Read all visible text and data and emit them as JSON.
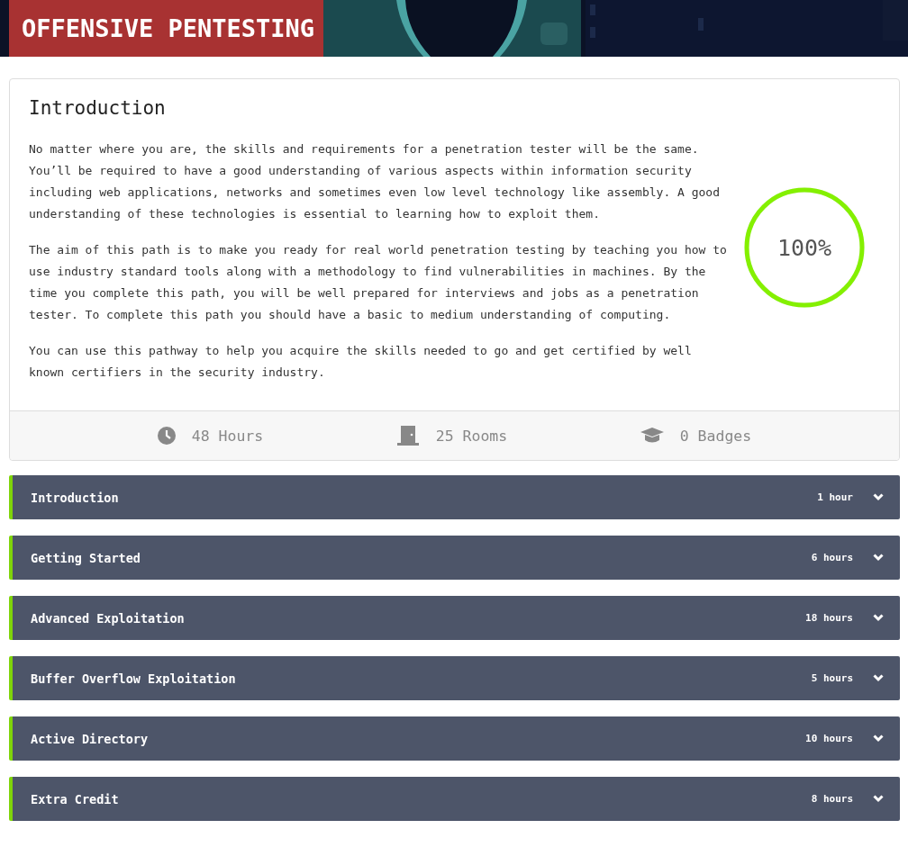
{
  "banner": {
    "title": "OFFENSIVE PENTESTING"
  },
  "intro": {
    "heading": "Introduction",
    "paragraphs": [
      "No matter where you are, the skills and requirements for a penetration tester will be the same. You’ll be required to have a good understanding of various aspects within information security including web applications, networks and sometimes even low level technology like assembly. A good understanding of these technologies is essential to learning how to exploit them.",
      "The aim of this path is to make you ready for real world penetration testing by teaching you how to use industry standard tools along with a methodology to find vulnerabilities in machines. By the time you complete this path, you will be well prepared for interviews and jobs as a penetration tester. To complete this path you should have a basic to medium understanding of computing.",
      "You can use this pathway to help you acquire the skills needed to go and get certified by well known certifiers in the security industry."
    ],
    "progress": {
      "level": 1,
      "reading": "100%"
    },
    "stats": [
      {
        "kind": "hours",
        "text": "48 Hours"
      },
      {
        "kind": "rooms",
        "text": "25 Rooms"
      },
      {
        "kind": "badges",
        "text": "0 Badges"
      }
    ]
  },
  "modules": [
    {
      "title": "Introduction",
      "duration": "1 hour"
    },
    {
      "title": "Getting Started",
      "duration": "6 hours"
    },
    {
      "title": "Advanced Exploitation",
      "duration": "18 hours"
    },
    {
      "title": "Buffer Overflow Exploitation",
      "duration": "5 hours"
    },
    {
      "title": "Active Directory",
      "duration": "10 hours"
    },
    {
      "title": "Extra Credit",
      "duration": "8 hours"
    }
  ]
}
